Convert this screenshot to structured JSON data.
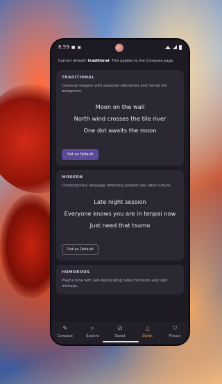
{
  "status_bar": {
    "time": "8:59"
  },
  "header": {
    "current_prefix": "Current default: ",
    "current_value": "traditional",
    "current_suffix": ". This applies to the Compose page."
  },
  "styles": [
    {
      "title": "TRADITIONAL",
      "description": "Classical imagery with seasonal references and formal tile metaphors.",
      "poem": [
        "Moon on the wall",
        "North wind crosses the tile river",
        "One dot awaits the moon"
      ],
      "button": "Set as Default"
    },
    {
      "title": "MODERN",
      "description": "Contemporary language reflecting present day table culture.",
      "poem": [
        "Late night session",
        "Everyone knows you are in tenpai now",
        "Just need that tsumo"
      ],
      "button": "Set as Default"
    },
    {
      "title": "HUMOROUS",
      "description": "Playful tone with self-deprecating table moments and light mishaps."
    }
  ],
  "nav": [
    {
      "label": "Compose",
      "icon": "compose-icon",
      "glyph": "✎"
    },
    {
      "label": "Explore",
      "icon": "explore-icon",
      "glyph": "⌕"
    },
    {
      "label": "Saved",
      "icon": "saved-icon",
      "glyph": "☑"
    },
    {
      "label": "Styles",
      "icon": "styles-icon",
      "glyph": "△"
    },
    {
      "label": "Privacy",
      "icon": "privacy-icon",
      "glyph": "⛉"
    }
  ],
  "active_tab": "Styles",
  "colors": {
    "accent": "#e1b04e",
    "primary_button": "#5b4a98",
    "card": "#2b2733",
    "surface": "#1d1a24"
  }
}
